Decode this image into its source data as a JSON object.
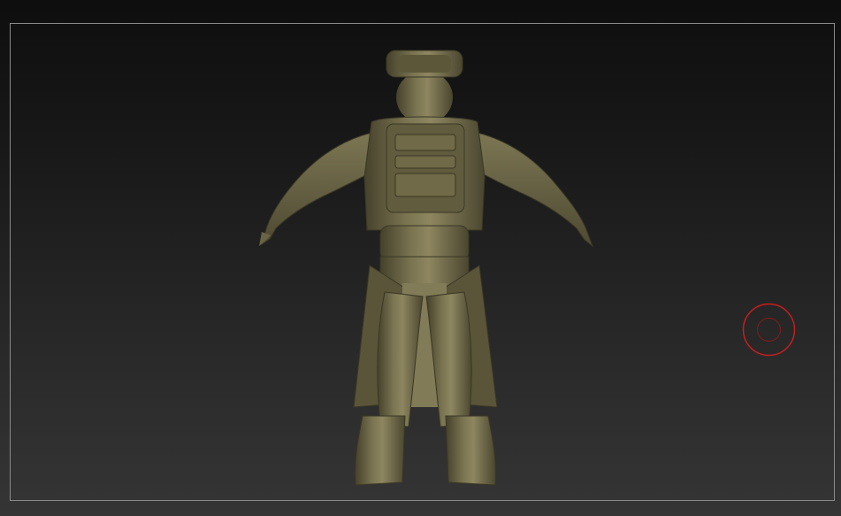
{
  "viewport": {
    "background_top": "#0e0e0e",
    "background_bottom": "#353535",
    "frame_color": "#8a8a8a"
  },
  "model": {
    "material_color": "#6f6a4a",
    "highlight_color": "#9a946a",
    "shadow_color": "#3e3b27",
    "icon": "character-sculpt"
  },
  "brush_cursor": {
    "color": "#c81e1e",
    "icon": "brush-circle"
  }
}
